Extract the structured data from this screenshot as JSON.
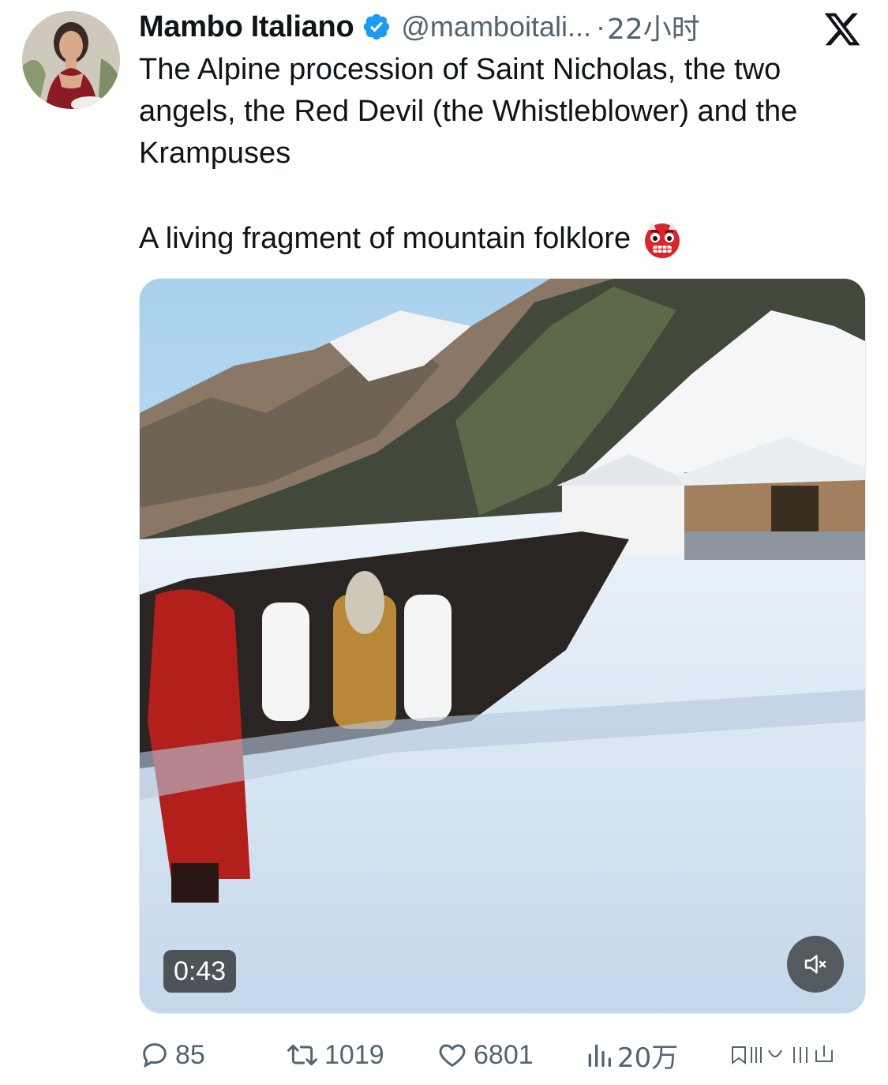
{
  "author": {
    "display_name": "Mambo Italiano",
    "handle": "@mamboitali...",
    "separator": "·",
    "time": "22小时",
    "verified": true
  },
  "platform": {
    "logo": "x-logo-icon"
  },
  "tweet": {
    "text": "The Alpine procession of Saint Nicholas, the two angels, the Red Devil (the Whistleblower) and the Krampuses",
    "text2": "A living fragment of mountain folklore",
    "emoji": "ogre-face-emoji"
  },
  "media": {
    "type": "video",
    "duration": "0:43",
    "muted": true,
    "mute_icon": "speaker-muted-icon"
  },
  "actions": {
    "replies": "85",
    "retweets": "1019",
    "likes": "6801",
    "views": "20万"
  },
  "colors": {
    "text": "#0f1419",
    "secondary": "#536471",
    "verified_blue": "#1d9bf0"
  }
}
